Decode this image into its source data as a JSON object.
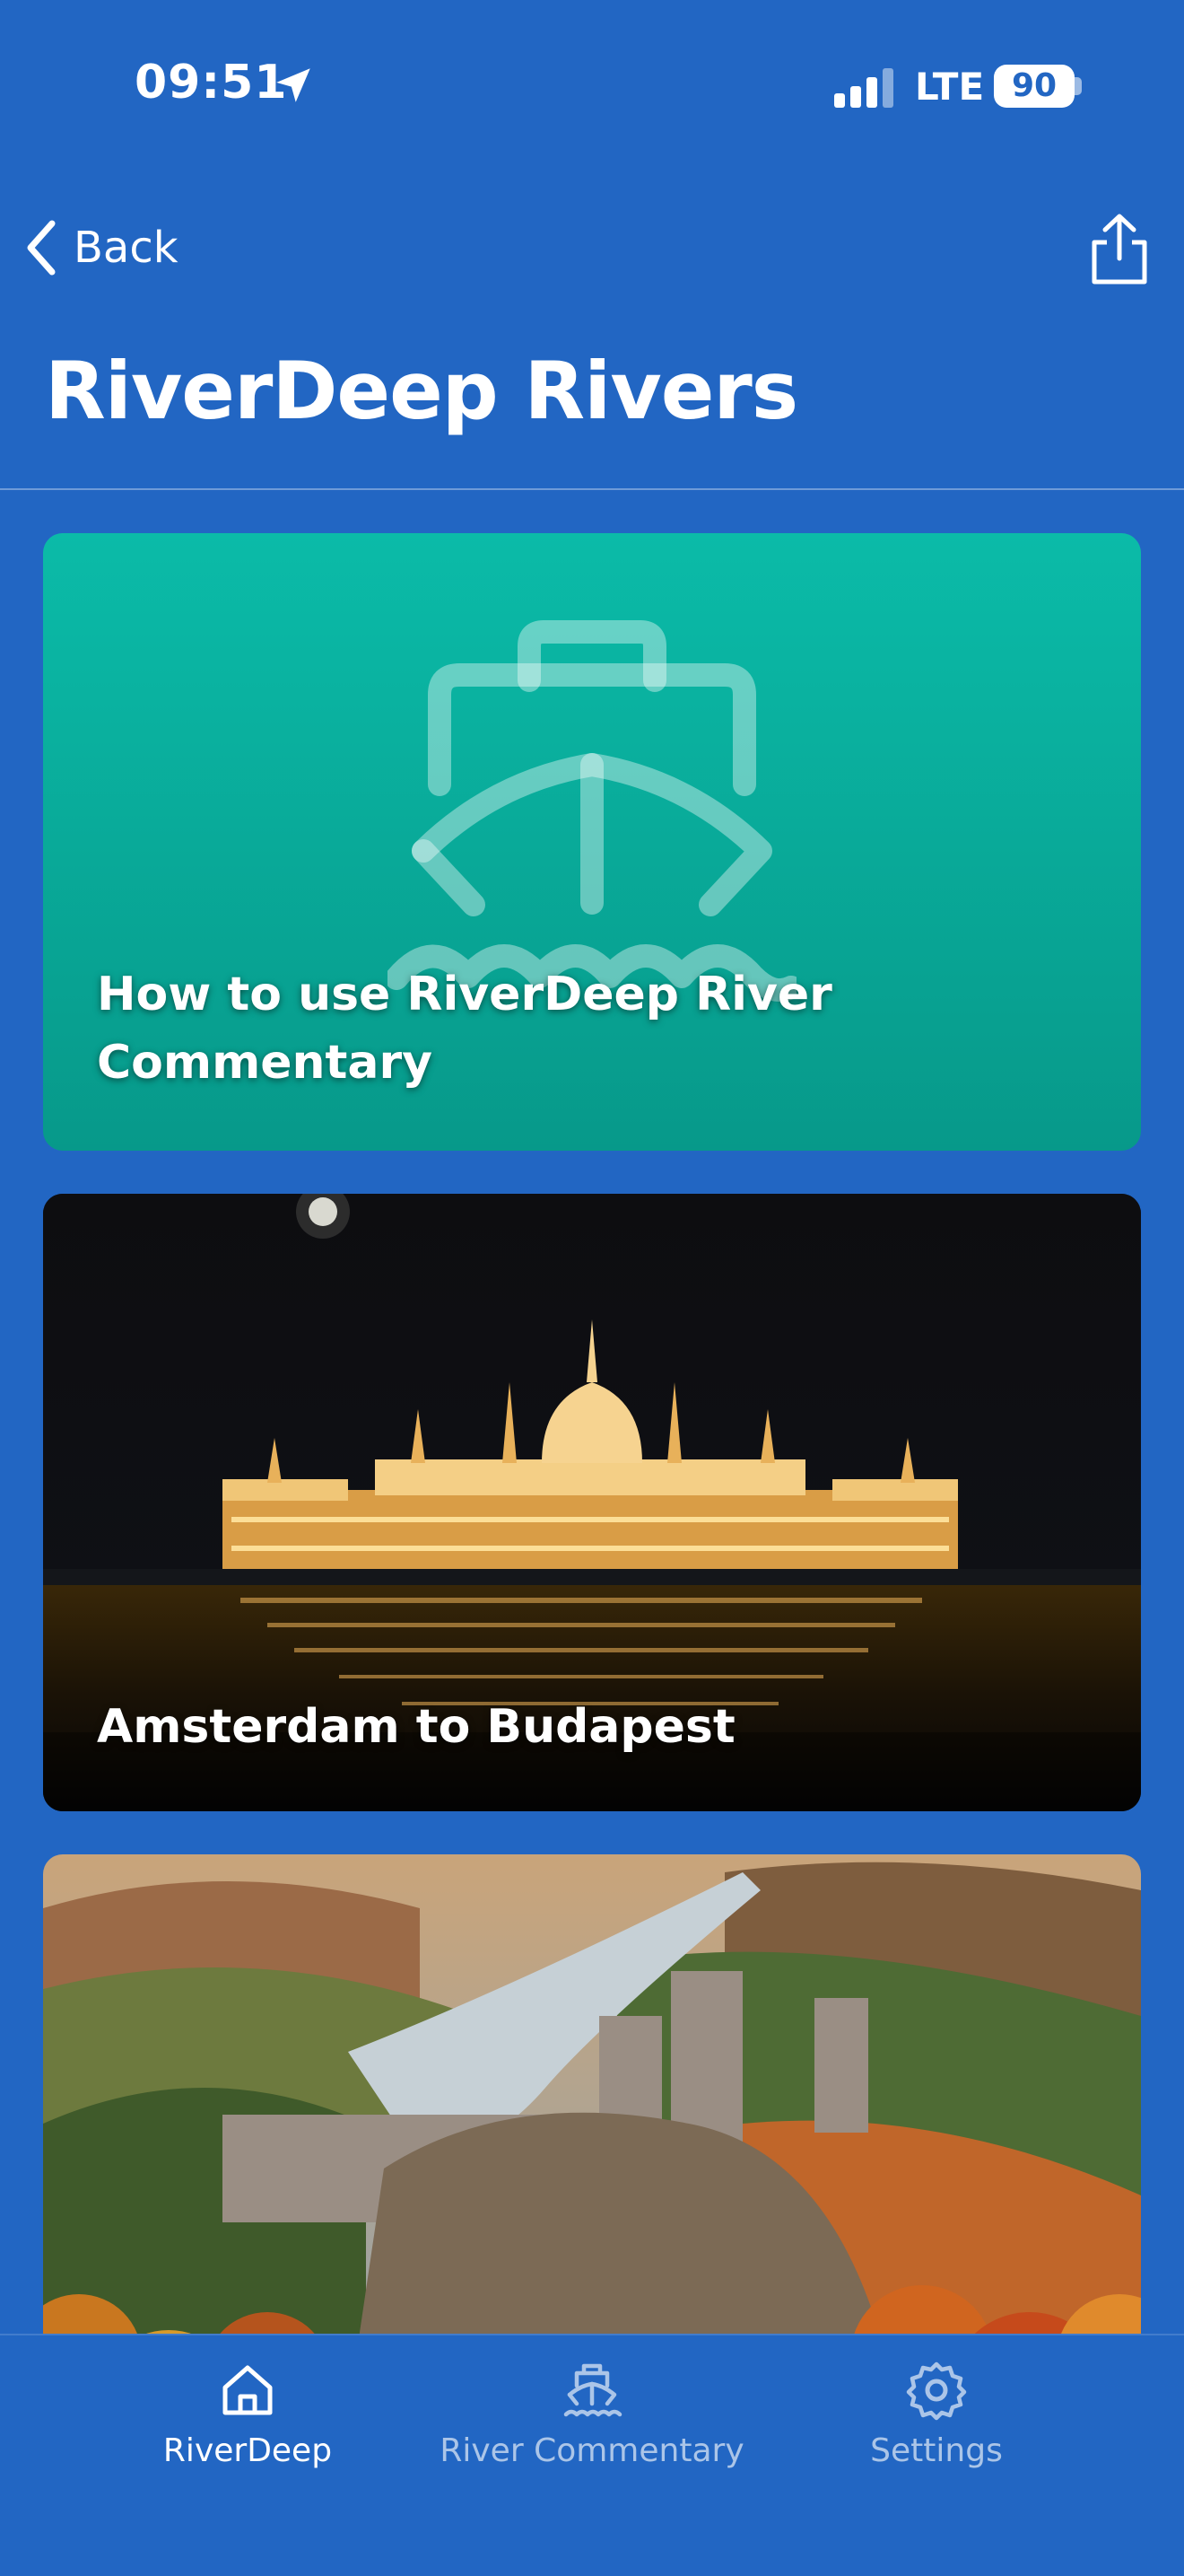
{
  "status_bar": {
    "time": "09:51",
    "network": "LTE",
    "battery": "90",
    "icons": [
      "location-arrow-icon",
      "signal-bars-icon",
      "battery-icon"
    ]
  },
  "nav": {
    "back_label": "Back",
    "back_icon": "chevron-left-icon",
    "share_icon": "share-icon",
    "title": "RiverDeep Rivers"
  },
  "cards": [
    {
      "title": "How to use RiverDeep River Commentary",
      "icon": "ship-icon",
      "colors": [
        "#0bbba8",
        "#07998a"
      ]
    },
    {
      "title": "Amsterdam to Budapest",
      "image": "night-parliament-river-photo"
    },
    {
      "title": "",
      "image": "castle-river-valley-autumn-photo"
    }
  ],
  "tabbar": {
    "tabs": [
      {
        "label": "RiverDeep",
        "icon": "home-icon",
        "selected": true
      },
      {
        "label": "River Commentary",
        "icon": "ship-icon",
        "selected": false
      },
      {
        "label": "Settings",
        "icon": "gear-icon",
        "selected": false
      }
    ]
  },
  "colors": {
    "background": "#2266c3",
    "accent_teal": "#0bbba8"
  }
}
